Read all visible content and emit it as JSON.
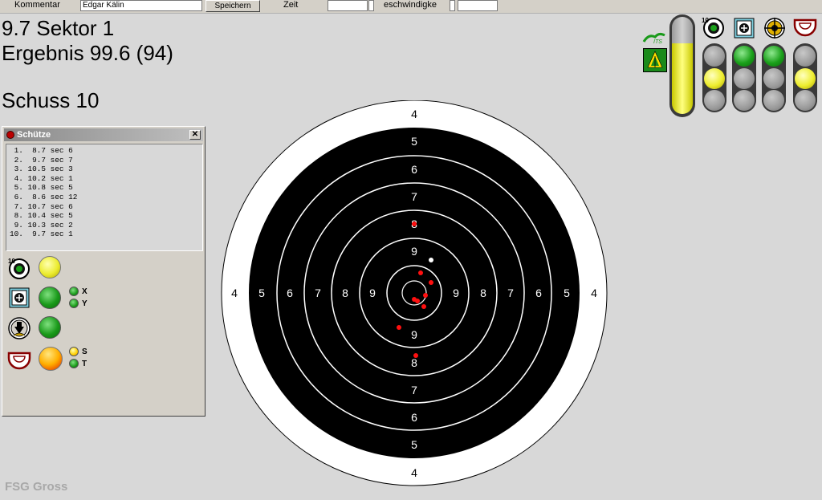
{
  "toolbar": {
    "kommentar_label": "Kommentar",
    "kommentar_value": "Edgar Kälin",
    "save_label": "Speichern",
    "zeit_label": "Zeit",
    "speed_label": "eschwindigke"
  },
  "result": {
    "last_shot": "9.7 Sektor 1",
    "ergebnis": "Ergebnis 99.6 (94)",
    "schuss": "Schuss 10"
  },
  "panel": {
    "title": "Schütze",
    "close_label": "✕",
    "shots": [
      " 1.  8.7 sec 6",
      " 2.  9.7 sec 7",
      " 3. 10.5 sec 3",
      " 4. 10.2 sec 1",
      " 5. 10.8 sec 5",
      " 6.  8.6 sec 12",
      " 7. 10.7 sec 6",
      " 8. 10.4 sec 5",
      " 9. 10.3 sec 2",
      "10.  9.7 sec 1"
    ],
    "indicators": {
      "x_label": "X",
      "y_label": "Y",
      "s_label": "S",
      "t_label": "T",
      "ten_label": "10"
    }
  },
  "target": {
    "ring_labels": {
      "r4": "4",
      "r5": "5",
      "r6": "6",
      "r7": "7",
      "r8": "8",
      "r9": "9"
    },
    "colors": {
      "black": "#000000",
      "shot": "#ff1010",
      "last_shot": "#ffffff"
    }
  },
  "status": {
    "ten_label": "10"
  },
  "watermark": "FSG Gross"
}
